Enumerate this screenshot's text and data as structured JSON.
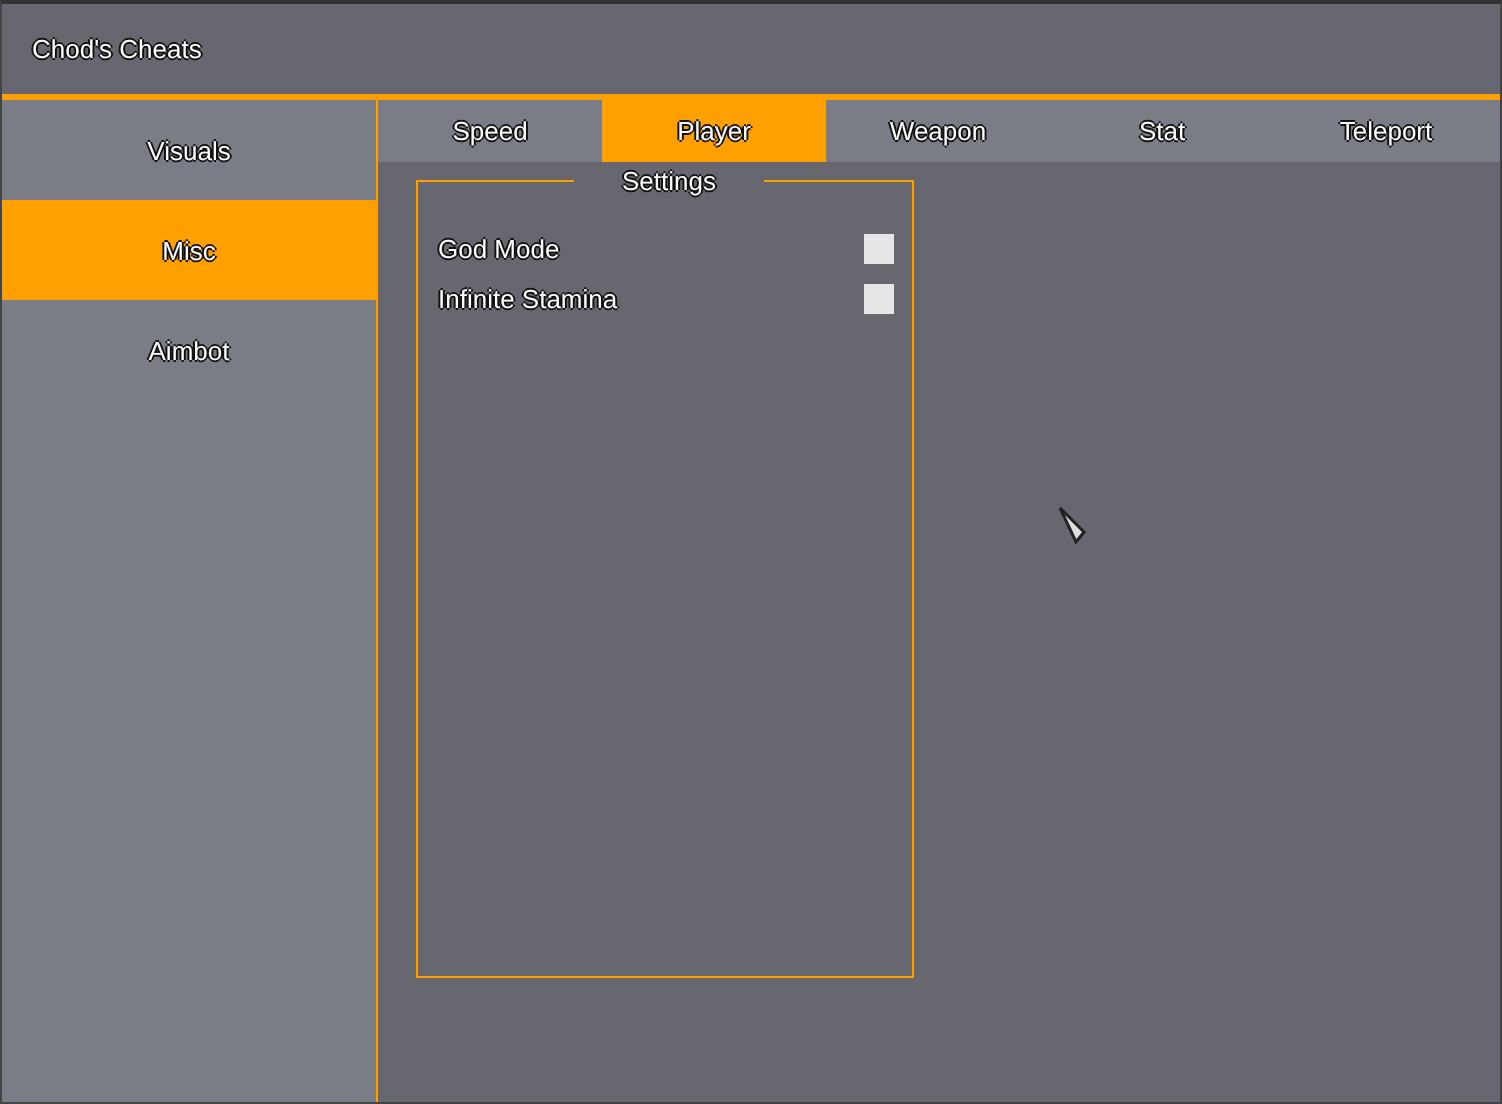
{
  "window": {
    "title": "Chod's Cheats"
  },
  "sidebar": {
    "items": [
      {
        "label": "Visuals",
        "selected": false
      },
      {
        "label": "Misc",
        "selected": true
      },
      {
        "label": "Aimbot",
        "selected": false
      }
    ]
  },
  "tabs": [
    {
      "label": "Speed",
      "selected": false
    },
    {
      "label": "Player",
      "selected": true
    },
    {
      "label": "Weapon",
      "selected": false
    },
    {
      "label": "Stat",
      "selected": false
    },
    {
      "label": "Teleport",
      "selected": false
    }
  ],
  "group": {
    "title": "Settings",
    "options": [
      {
        "label": "God Mode",
        "checked": false
      },
      {
        "label": "Infinite Stamina",
        "checked": false
      }
    ]
  }
}
